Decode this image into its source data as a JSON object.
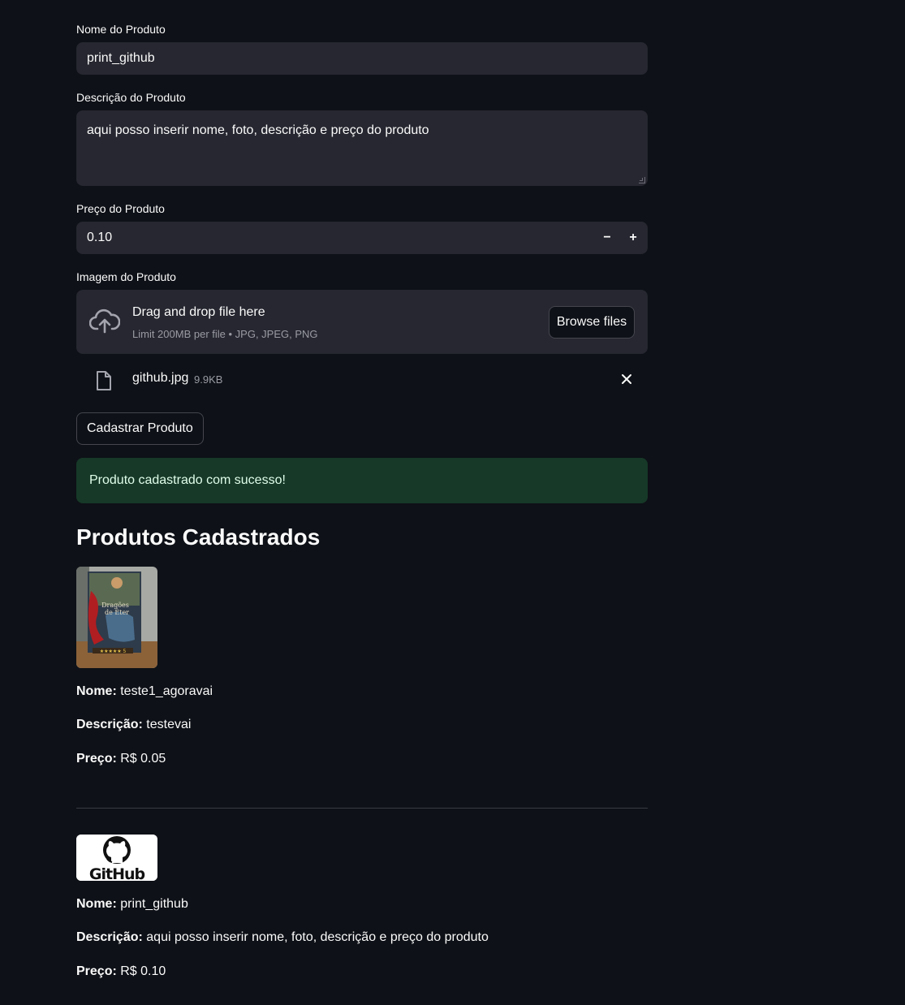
{
  "form": {
    "name_label": "Nome do Produto",
    "name_value": "print_github",
    "description_label": "Descrição do Produto",
    "description_value": "aqui posso inserir nome, foto, descrição e preço do produto",
    "price_label": "Preço do Produto",
    "price_value": "0.10",
    "price_minus": "−",
    "price_plus": "+",
    "image_label": "Imagem do Produto",
    "dropzone_title": "Drag and drop file here",
    "dropzone_limit": "Limit 200MB per file • JPG, JPEG, PNG",
    "browse_label": "Browse files",
    "uploaded_file_name": "github.jpg",
    "uploaded_file_size": "9.9KB",
    "submit_label": "Cadastrar Produto"
  },
  "alert": {
    "success_text": "Produto cadastrado com sucesso!",
    "color": "#173928"
  },
  "products_section": {
    "title": "Produtos Cadastrados",
    "name_prefix": "Nome:",
    "description_prefix": "Descrição:",
    "price_prefix": "Preço:",
    "items": [
      {
        "name": "teste1_agoravai",
        "description": "testevai",
        "price": "R$ 0.05",
        "image_text": "Dragões de Éter"
      },
      {
        "name": "print_github",
        "description": "aqui posso inserir nome, foto, descrição e preço do produto",
        "price": "R$ 0.10",
        "image_text": "GitHub"
      }
    ]
  },
  "colors": {
    "background": "#0e1117",
    "input_background": "#262730",
    "text": "#fafafa"
  }
}
